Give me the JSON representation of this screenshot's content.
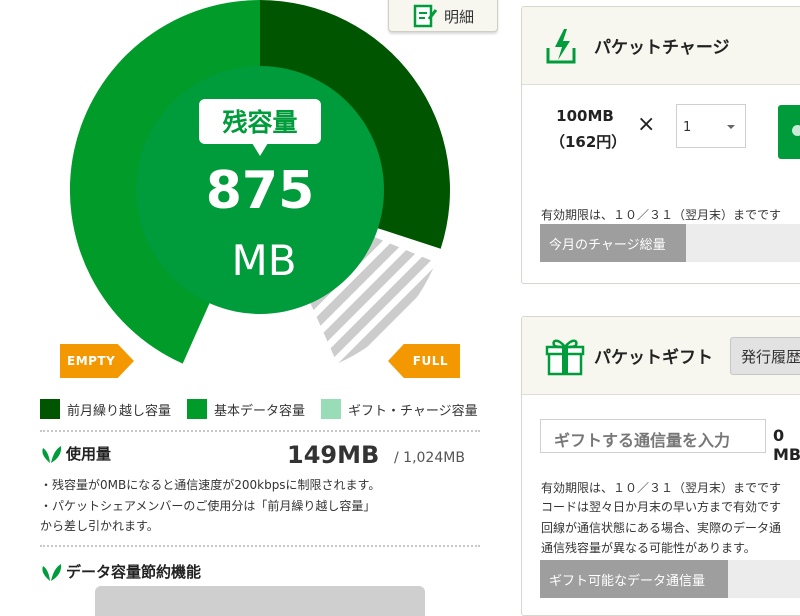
{
  "header": {
    "detail_button_label": "明細"
  },
  "gauge": {
    "title": "残容量",
    "value": "875",
    "unit": "MB",
    "empty_label": "EMPTY",
    "full_label": "FULL",
    "colors": {
      "carryover": "#005500",
      "basic": "#009b28",
      "gift": "#cccccc",
      "inner": "#009b3a"
    }
  },
  "legend": [
    {
      "label": "前月繰り越し容量",
      "color": "#005500"
    },
    {
      "label": "基本データ容量",
      "color": "#009b28"
    },
    {
      "label": "ギフト・チャージ容量",
      "color": "#99dcb8"
    }
  ],
  "usage": {
    "title": "使用量",
    "value": "149MB",
    "total": "/ 1,024MB",
    "notes": [
      "・残容量が0MBになると通信速度が200kbpsに制限されます。",
      "・パケットシェアメンバーのご使用分は「前月繰り越し容量」",
      "から差し引かれます。"
    ]
  },
  "saving": {
    "title": "データ容量節約機能"
  },
  "charge": {
    "title": "パケットチャージ",
    "amount_line1": "100MB",
    "amount_line2": "（162円）",
    "times_symbol": "×",
    "quantity": "1",
    "expiry_note": "有効期限は、１０／３１（翌月末）までです",
    "total_label": "今月のチャージ総量"
  },
  "gift": {
    "title": "パケットギフト",
    "history_button": "発行履歴",
    "input_placeholder": "ギフトする通信量を入力",
    "input_unit": "0 MB",
    "notes": [
      "有効期限は、１０／３１（翌月末）までです",
      "コードは翌々日か月末の早い方まで有効です",
      "回線が通信状態にある場合、実際のデータ通",
      "通信残容量が異なる可能性があります。"
    ],
    "available_label": "ギフト可能なデータ通信量"
  }
}
